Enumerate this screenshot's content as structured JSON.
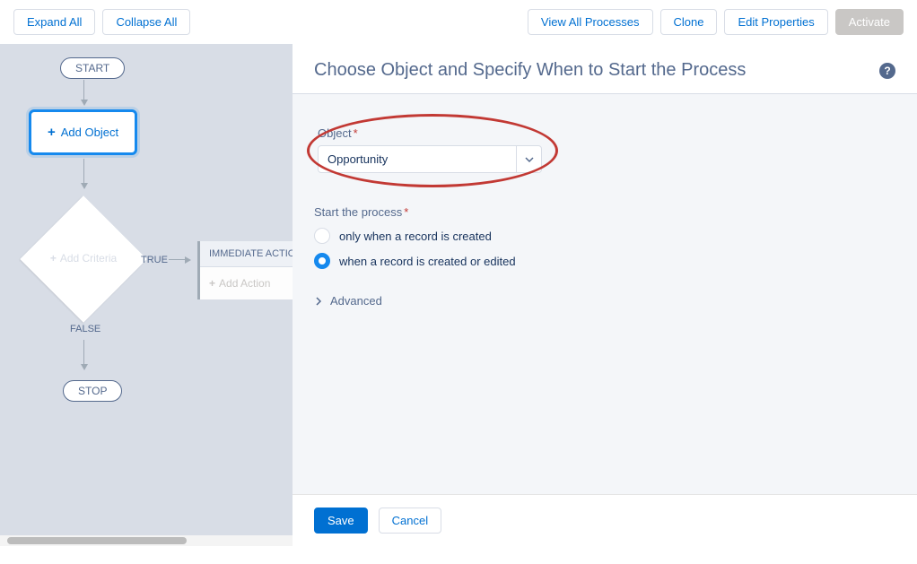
{
  "toolbar": {
    "expand_all": "Expand All",
    "collapse_all": "Collapse All",
    "view_all": "View All Processes",
    "clone": "Clone",
    "edit_props": "Edit Properties",
    "activate": "Activate"
  },
  "canvas": {
    "start": "START",
    "add_object": "Add Object",
    "add_criteria": "Add Criteria",
    "true_label": "TRUE",
    "false_label": "FALSE",
    "stop": "STOP",
    "immediate_header": "IMMEDIATE ACTIONS",
    "add_action": "Add Action"
  },
  "panel": {
    "title": "Choose Object and Specify When to Start the Process",
    "object_label": "Object",
    "object_value": "Opportunity",
    "start_label": "Start the process",
    "radio_created": "only when a record is created",
    "radio_created_edited": "when a record is created or edited",
    "advanced": "Advanced",
    "save": "Save",
    "cancel": "Cancel"
  }
}
